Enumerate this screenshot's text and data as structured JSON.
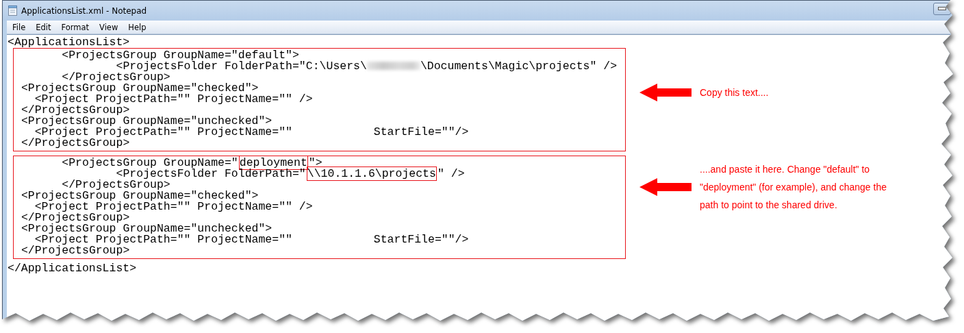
{
  "window": {
    "title": "ApplicationsList.xml - Notepad"
  },
  "menu": [
    "File",
    "Edit",
    "Format",
    "View",
    "Help"
  ],
  "document": [
    {
      "kind": "line",
      "segments": [
        {
          "kind": "plain",
          "text": "<ApplicationsList>"
        }
      ]
    },
    {
      "kind": "frame",
      "lines": [
        {
          "segments": [
            {
              "kind": "plain",
              "text": "       <ProjectsGroup GroupName=\"default\">"
            }
          ]
        },
        {
          "segments": [
            {
              "kind": "plain",
              "text": "               <ProjectsFolder FolderPath=\"C:\\Users\\"
            },
            {
              "kind": "redacted"
            },
            {
              "kind": "plain",
              "text": "\\Documents\\Magic\\projects\" />"
            }
          ]
        },
        {
          "segments": [
            {
              "kind": "plain",
              "text": "       </ProjectsGroup>"
            }
          ]
        },
        {
          "segments": [
            {
              "kind": "plain",
              "text": " <ProjectsGroup GroupName=\"checked\">"
            }
          ]
        },
        {
          "segments": [
            {
              "kind": "plain",
              "text": "   <Project ProjectPath=\"\" ProjectName=\"\" />"
            }
          ]
        },
        {
          "segments": [
            {
              "kind": "plain",
              "text": " </ProjectsGroup>"
            }
          ]
        },
        {
          "segments": [
            {
              "kind": "plain",
              "text": " <ProjectsGroup GroupName=\"unchecked\">"
            }
          ]
        },
        {
          "segments": [
            {
              "kind": "plain",
              "text": "   <Project ProjectPath=\"\" ProjectName=\"\"            StartFile=\"\"/>"
            }
          ]
        },
        {
          "segments": [
            {
              "kind": "plain",
              "text": " </ProjectsGroup>"
            }
          ]
        }
      ]
    },
    {
      "kind": "frame",
      "lines": [
        {
          "segments": [
            {
              "kind": "plain",
              "text": "       <ProjectsGroup GroupName=\""
            },
            {
              "kind": "boxed",
              "text": "deployment"
            },
            {
              "kind": "plain",
              "text": "\">"
            }
          ]
        },
        {
          "segments": [
            {
              "kind": "plain",
              "text": "               <ProjectsFolder FolderPath=\""
            },
            {
              "kind": "boxed",
              "text": "\\\\10.1.1.6\\projects"
            },
            {
              "kind": "plain",
              "text": "\" />"
            }
          ]
        },
        {
          "segments": [
            {
              "kind": "plain",
              "text": "       </ProjectsGroup>"
            }
          ]
        },
        {
          "segments": [
            {
              "kind": "plain",
              "text": " <ProjectsGroup GroupName=\"checked\">"
            }
          ]
        },
        {
          "segments": [
            {
              "kind": "plain",
              "text": "   <Project ProjectPath=\"\" ProjectName=\"\" />"
            }
          ]
        },
        {
          "segments": [
            {
              "kind": "plain",
              "text": " </ProjectsGroup>"
            }
          ]
        },
        {
          "segments": [
            {
              "kind": "plain",
              "text": " <ProjectsGroup GroupName=\"unchecked\">"
            }
          ]
        },
        {
          "segments": [
            {
              "kind": "plain",
              "text": "   <Project ProjectPath=\"\" ProjectName=\"\"            StartFile=\"\"/>"
            }
          ]
        },
        {
          "segments": [
            {
              "kind": "plain",
              "text": " </ProjectsGroup>"
            }
          ]
        }
      ]
    },
    {
      "kind": "line",
      "segments": [
        {
          "kind": "plain",
          "text": "</ApplicationsList>"
        }
      ]
    }
  ],
  "annotations": [
    {
      "text": "Copy this text...."
    },
    {
      "text": "....and paste it here. Change \"default\" to \"deployment\" (for example), and change the path to point to the shared drive."
    }
  ]
}
